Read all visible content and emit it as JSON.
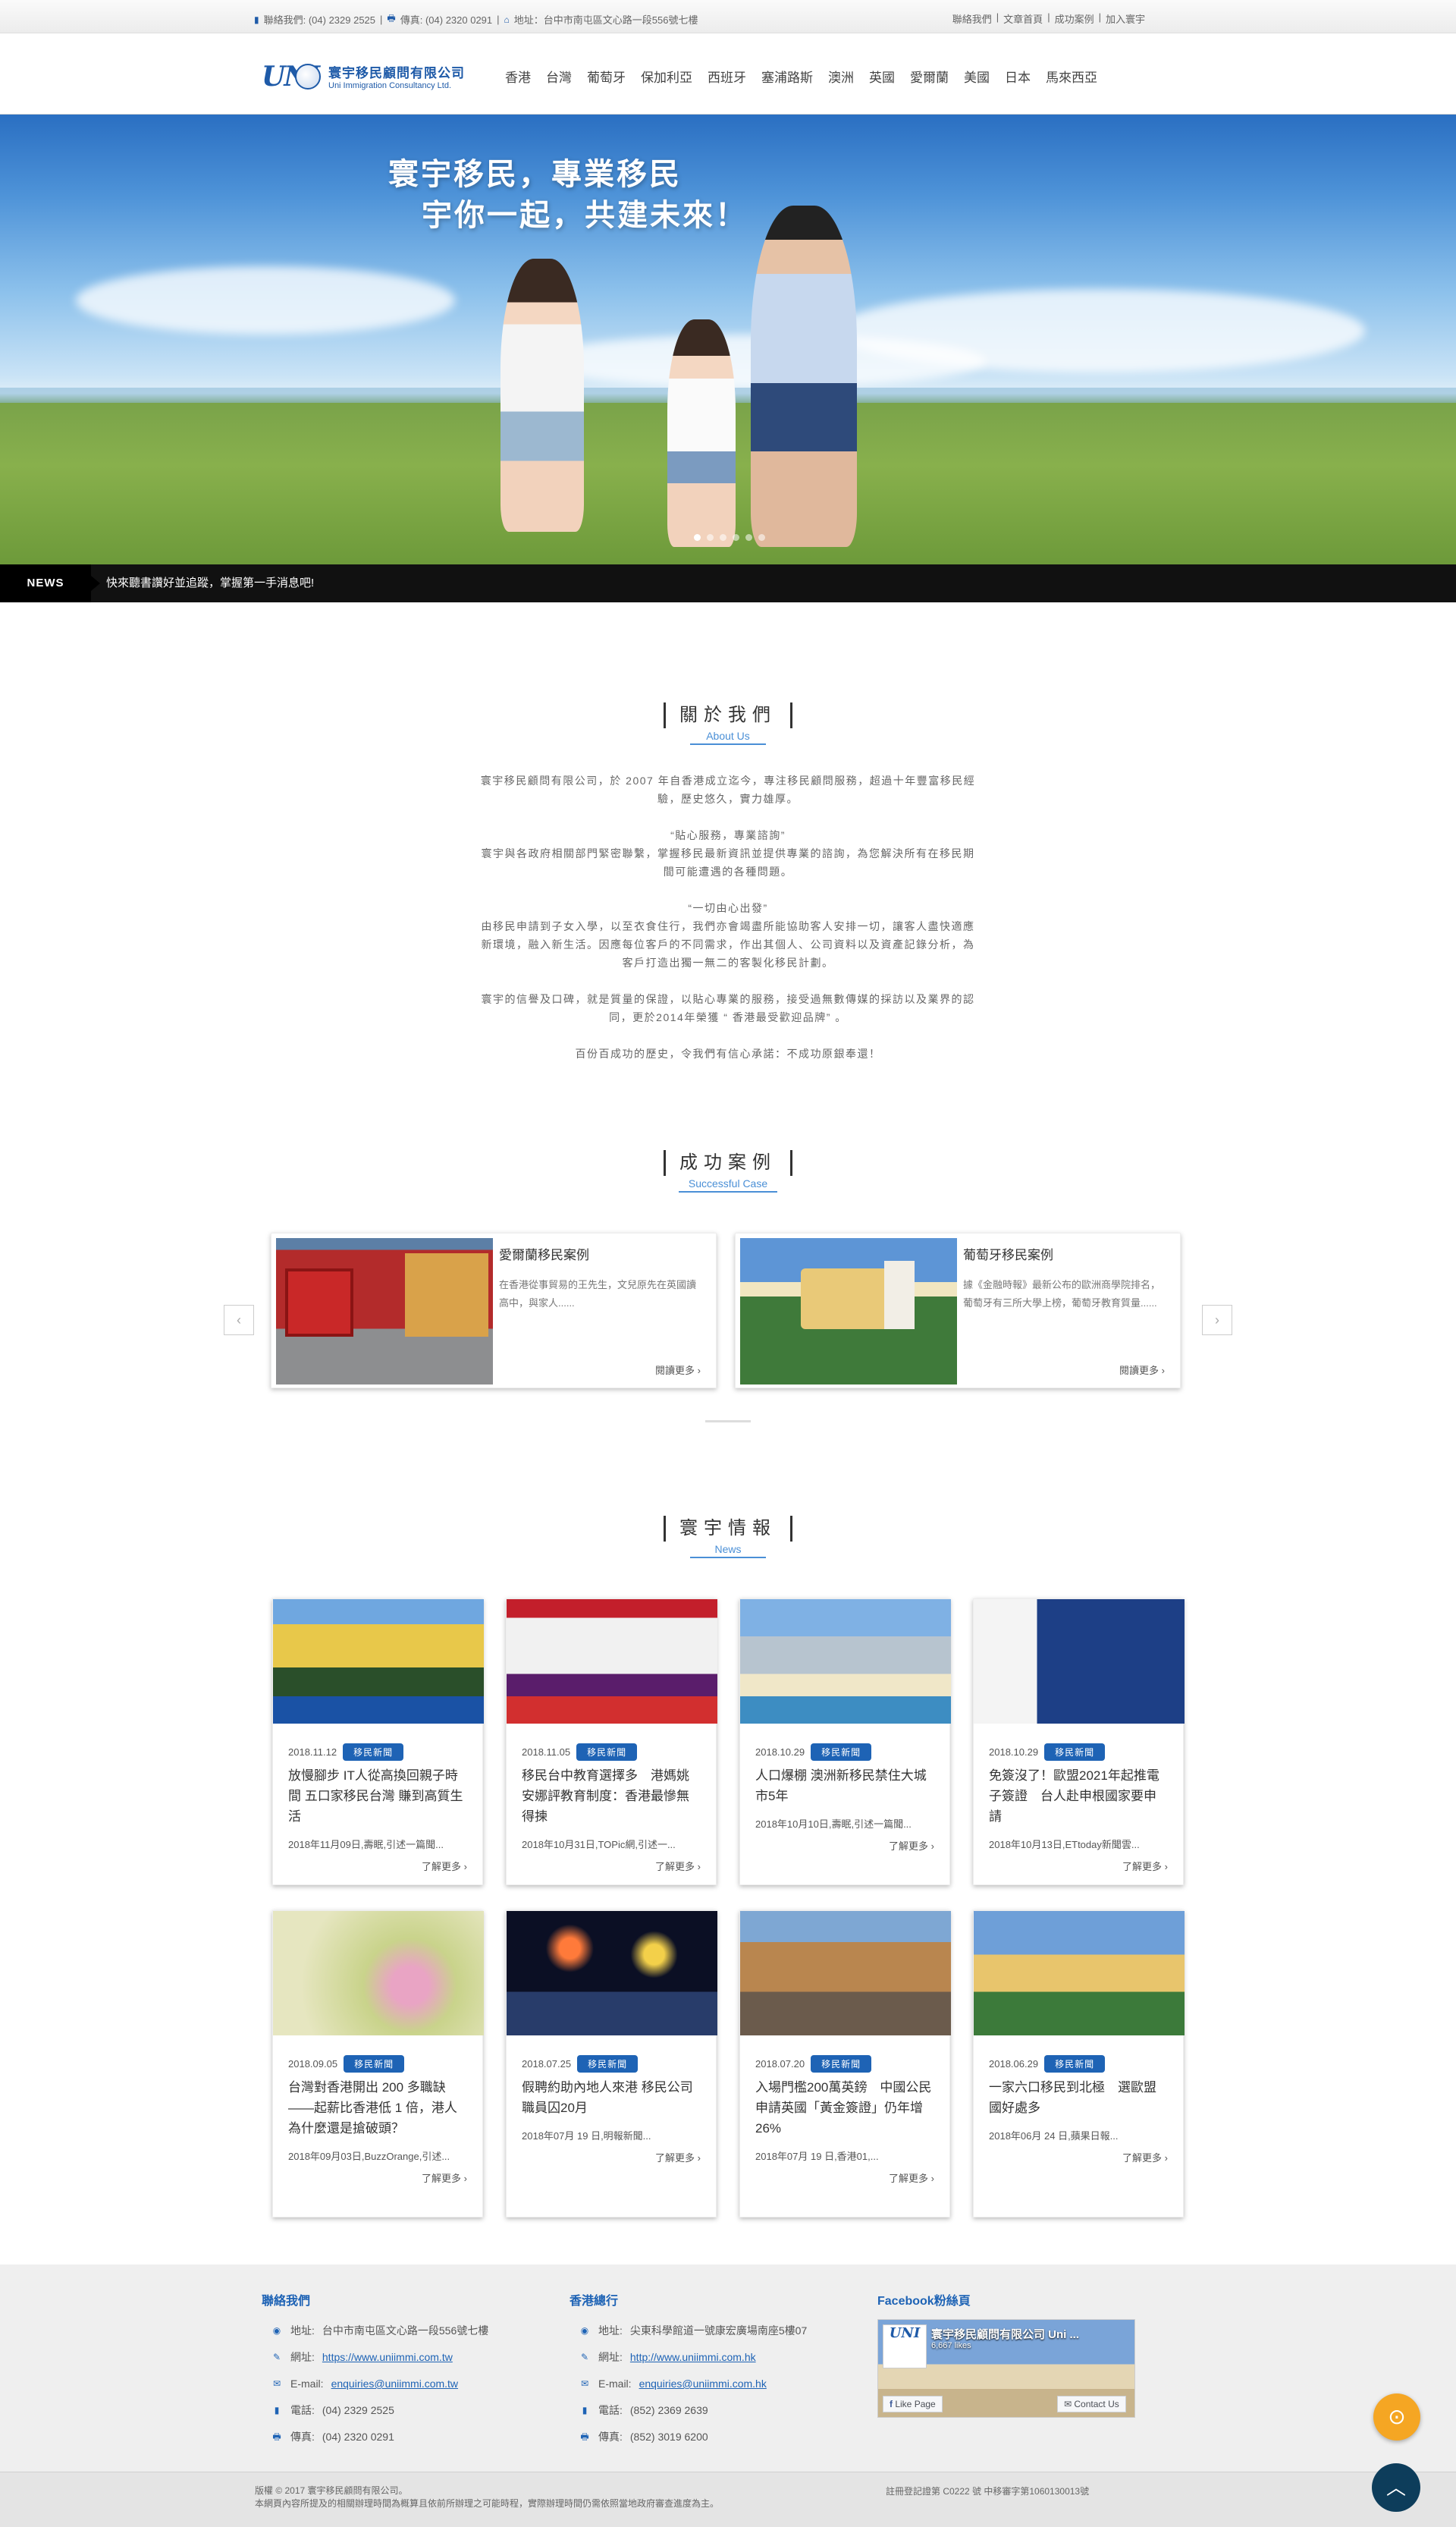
{
  "topbar": {
    "contact": "聯絡我們: (04) 2329 2525",
    "fax": "傳真: (04) 2320 0291",
    "address": "地址：台中市南屯區文心路一段556號七樓",
    "links": [
      "聯絡我們",
      "文章首頁",
      "成功案例",
      "加入寰宇"
    ]
  },
  "header": {
    "logo_mark": "UNI",
    "logo_cn": "寰宇移民顧問有限公司",
    "logo_en": "Uni Immigration Consultancy Ltd.",
    "nav": [
      "香港",
      "台灣",
      "葡萄牙",
      "保加利亞",
      "西班牙",
      "塞浦路斯",
      "澳洲",
      "英國",
      "愛爾蘭",
      "美國",
      "日本",
      "馬來西亞"
    ]
  },
  "hero": {
    "slogan_line1": "寰宇移民，專業移民",
    "slogan_line2": "宇你一起，共建未來！",
    "slides": 6,
    "active_slide": 1
  },
  "ticker": {
    "label": "NEWS",
    "text": "快來聽書讚好並追蹤，掌握第一手消息吧!"
  },
  "about": {
    "title_cn": "關於我們",
    "title_en": "About Us",
    "paragraphs": [
      "寰宇移民顧問有限公司，於 2007 年自香港成立迄今，專注移民顧問服務，超過十年豐富移民經驗，歷史悠久，實力雄厚。",
      "“貼心服務，專業諮詢”\n寰宇與各政府相關部門緊密聯繫，掌握移民最新資訊並提供專業的諮詢，為您解決所有在移民期間可能遭遇的各種問題。",
      "“一切由心出發”\n由移民申請到子女入學，以至衣食住行，我們亦會竭盡所能協助客人安排一切，讓客人盡快適應新環境，融入新生活。因應每位客戶的不同需求，作出其個人、公司資料以及資產記錄分析，為客戶打造出獨一無二的客製化移民計劃。",
      "寰宇的信譽及口碑，就是質量的保證，以貼心專業的服務，接受過無數傳媒的採訪以及業界的認同，更於2014年榮獲 “ 香港最受歡迎品牌” 。",
      "百份百成功的歷史，令我們有信心承諾：不成功原銀奉還！"
    ]
  },
  "cases": {
    "title_cn": "成功案例",
    "title_en": "Successful Case",
    "prev": "‹",
    "next": "›",
    "items": [
      {
        "title": "愛爾蘭移民案例",
        "desc": "在香港從事貿易的王先生，文兒原先在英國讀高中，與家人......",
        "more": "閱讀更多"
      },
      {
        "title": "葡萄牙移民案例",
        "desc": "據《金融時報》最新公布的歐洲商學院排名，葡萄牙有三所大學上榜，葡萄牙教育質量......",
        "more": "閱讀更多"
      }
    ]
  },
  "news": {
    "title_cn": "寰宇情報",
    "title_en": "News",
    "badge": "移民新聞",
    "more": "了解更多",
    "items": [
      {
        "date": "2018.11.12",
        "title": "放慢腳步 IT人從高換回親子時間 五口家移民台灣 賺到高質生活",
        "summary": "2018年11月09日,壽眠,引述一篇聞..."
      },
      {
        "date": "2018.11.05",
        "title": "移民台中教育選擇多　港媽姚安娜評教育制度：香港最慘無得揀",
        "summary": "2018年10月31日,TOPic網,引述一..."
      },
      {
        "date": "2018.10.29",
        "title": "人口爆棚 澳洲新移民禁住大城市5年",
        "summary": "2018年10月10日,壽眠,引述一篇聞..."
      },
      {
        "date": "2018.10.29",
        "title": "免簽沒了！歐盟2021年起推電子簽證　台人赴申根國家要申請",
        "summary": "2018年10月13日,ETtoday新聞雲..."
      },
      {
        "date": "2018.09.05",
        "title": "台灣對香港開出 200 多職缺——起薪比香港低 1 倍，港人為什麼還是搶破頭？",
        "summary": "2018年09月03日,BuzzOrange,引述..."
      },
      {
        "date": "2018.07.25",
        "title": "假聘約助內地人來港 移民公司職員囚20月",
        "summary": "2018年07月 19 日,明報新聞..."
      },
      {
        "date": "2018.07.20",
        "title": "入場門檻200萬英鎊　中國公民申請英國「黃金簽證」仍年增26%",
        "summary": "2018年07月 19 日,香港01,..."
      },
      {
        "date": "2018.06.29",
        "title": "一家六口移民到北極　選歐盟國好處多",
        "summary": "2018年06月 24 日,蘋果日報..."
      }
    ]
  },
  "footer": {
    "contact_title": "聯絡我們",
    "contact_rows": [
      {
        "label": "地址:",
        "value": "台中市南屯區文心路一段556號七樓"
      },
      {
        "label": "網址:",
        "value": "https://www.uniimmi.com.tw"
      },
      {
        "label": "E-mail:",
        "value": "enquiries@uniimmi.com.tw"
      },
      {
        "label": "電話:",
        "value": "(04) 2329 2525"
      },
      {
        "label": "傳真:",
        "value": "(04) 2320 0291"
      }
    ],
    "hk_title": "香港總行",
    "hk_rows": [
      {
        "label": "地址:",
        "value": "尖東科學館道一號康宏廣場南座5樓07"
      },
      {
        "label": "網址:",
        "value": "http://www.uniimmi.com.hk"
      },
      {
        "label": "E-mail:",
        "value": "enquiries@uniimmi.com.hk"
      },
      {
        "label": "電話:",
        "value": "(852) 2369 2639"
      },
      {
        "label": "傳真:",
        "value": "(852) 3019 6200"
      }
    ],
    "fb_title": "Facebook粉絲頁",
    "fb_name": "寰宇移民顧問有限公司 Uni ...",
    "fb_likes": "6,667 likes",
    "fb_like_btn": "Like Page",
    "fb_contact_btn": "Contact Us",
    "copyright": "版權 © 2017 寰宇移民顧問有限公司。",
    "disclaimer": "本網頁內容所提及的相關辦理時間為概算且依前所辦理之可能時程，實際辦理時間仍需依照當地政府審查進度為主。",
    "license": "註冊登記證第 C0222 號 中移審字第1060130013號"
  },
  "fab": {
    "location_icon": "location-pin-icon",
    "top_icon": "chevron-up-icon"
  }
}
